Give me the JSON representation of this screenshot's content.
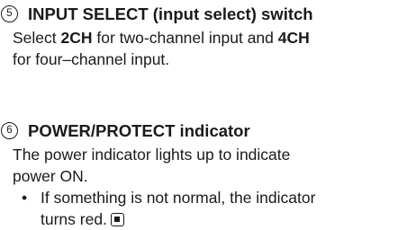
{
  "items": [
    {
      "number": "5",
      "title": "INPUT SELECT (input select) switch",
      "description": {
        "prefix": "Select ",
        "option_a": "2CH",
        "middle": " for two-channel input and ",
        "option_b": "4CH",
        "suffix": "for four–channel input."
      }
    },
    {
      "number": "6",
      "title": "POWER/PROTECT indicator",
      "description_line1": "The power indicator lights up to indicate",
      "description_line2": "power ON.",
      "bullet_char": "•",
      "bullet_line1": "If something is not normal, the indicator",
      "bullet_line2": "turns red."
    }
  ],
  "icons": {
    "end_mark": "end-of-section-icon"
  }
}
